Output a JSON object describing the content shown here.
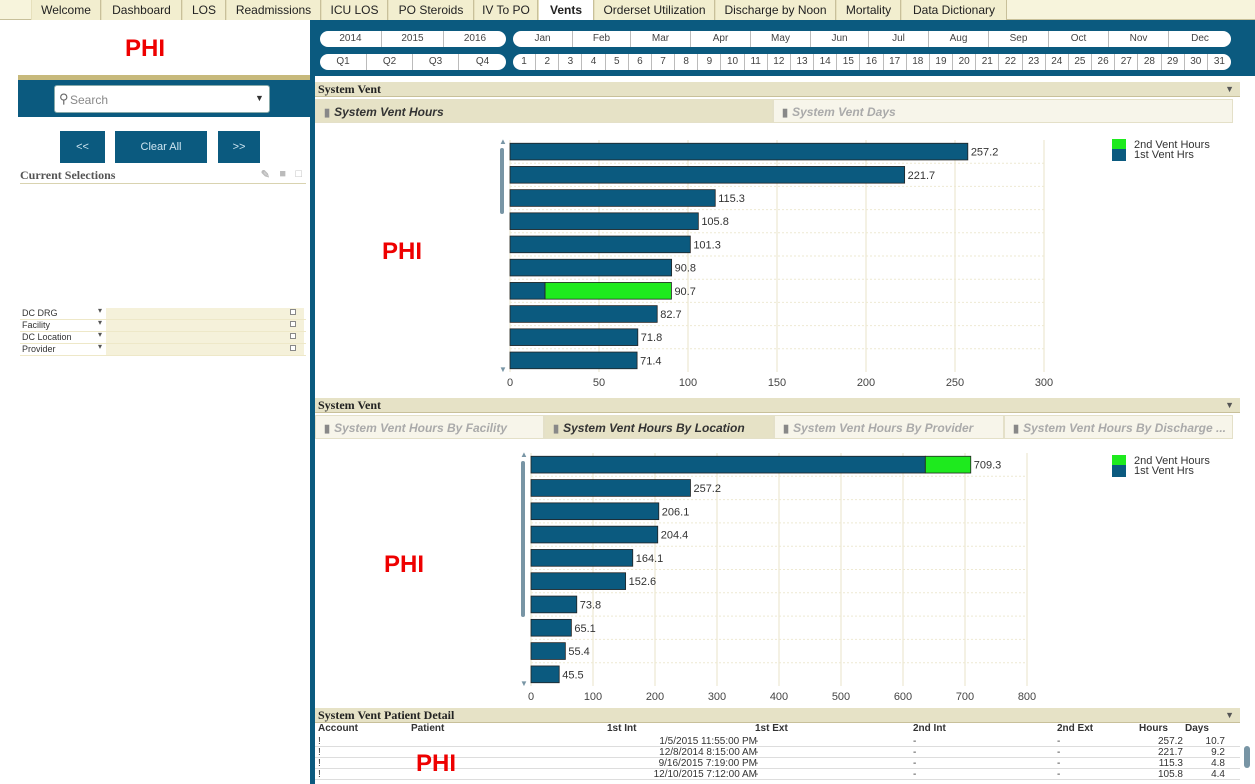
{
  "tabs": [
    {
      "label": "Welcome"
    },
    {
      "label": "Dashboard"
    },
    {
      "label": "LOS"
    },
    {
      "label": "Readmissions"
    },
    {
      "label": "ICU LOS"
    },
    {
      "label": "PO Steroids"
    },
    {
      "label": "IV To PO"
    },
    {
      "label": "Vents"
    },
    {
      "label": "Orderset Utilization"
    },
    {
      "label": "Discharge by Noon"
    },
    {
      "label": "Mortality"
    },
    {
      "label": "Data Dictionary"
    }
  ],
  "phi_label": "PHI",
  "years": [
    "2014",
    "2015",
    "2016"
  ],
  "months": [
    "Jan",
    "Feb",
    "Mar",
    "Apr",
    "May",
    "Jun",
    "Jul",
    "Aug",
    "Sep",
    "Oct",
    "Nov",
    "Dec"
  ],
  "quarters": [
    "Q1",
    "Q2",
    "Q3",
    "Q4"
  ],
  "days": [
    "1",
    "2",
    "3",
    "4",
    "5",
    "6",
    "7",
    "8",
    "9",
    "10",
    "11",
    "12",
    "13",
    "14",
    "15",
    "16",
    "17",
    "18",
    "19",
    "20",
    "21",
    "22",
    "23",
    "24",
    "25",
    "26",
    "27",
    "28",
    "29",
    "30",
    "31"
  ],
  "left": {
    "search_placeholder": "Search",
    "prev_label": "<<",
    "clear_label": "Clear All",
    "next_label": ">>",
    "current_selections": "Current Selections",
    "filters": [
      {
        "label": "DC DRG"
      },
      {
        "label": "Facility"
      },
      {
        "label": "DC Location"
      },
      {
        "label": "Provider"
      }
    ]
  },
  "section1": {
    "title": "System Vent",
    "tabs": [
      {
        "label": "System Vent Hours",
        "active": true
      },
      {
        "label": "System Vent Days",
        "active": false
      }
    ]
  },
  "section2": {
    "title": "System Vent",
    "tabs": [
      {
        "label": "System Vent Hours By Facility",
        "active": false
      },
      {
        "label": "System Vent Hours By Location",
        "active": true
      },
      {
        "label": "System Vent Hours By Provider",
        "active": false
      },
      {
        "label": "System Vent Hours By Discharge ...",
        "active": false
      }
    ]
  },
  "section3": {
    "title": "System Vent Patient Detail"
  },
  "legend": {
    "second": "2nd Vent Hours",
    "first": "1st Vent Hrs"
  },
  "colors": {
    "first": "#0b5a7f",
    "second": "#1eea1e",
    "nav": "#0b5a7f",
    "phi": "#e00000"
  },
  "chart_data": [
    {
      "type": "bar",
      "orientation": "horizontal",
      "stacked": true,
      "xlim": [
        0,
        300
      ],
      "xticks": [
        0,
        50,
        100,
        150,
        200,
        250,
        300
      ],
      "totals": [
        257.2,
        221.7,
        115.3,
        105.8,
        101.3,
        90.8,
        90.7,
        82.7,
        71.8,
        71.4
      ],
      "series": [
        {
          "name": "1st Vent Hrs",
          "values": [
            257.2,
            221.7,
            115.3,
            105.8,
            101.3,
            90.8,
            19.7,
            82.7,
            71.8,
            71.4
          ]
        },
        {
          "name": "2nd Vent Hours",
          "values": [
            0,
            0,
            0,
            0,
            0,
            0,
            71.0,
            0,
            0,
            0
          ]
        }
      ]
    },
    {
      "type": "bar",
      "orientation": "horizontal",
      "stacked": true,
      "xlim": [
        0,
        800
      ],
      "xticks": [
        0,
        100,
        200,
        300,
        400,
        500,
        600,
        700,
        800
      ],
      "totals": [
        709.3,
        257.2,
        206.1,
        204.4,
        164.1,
        152.6,
        73.8,
        65.1,
        55.4,
        45.5
      ],
      "series": [
        {
          "name": "1st Vent Hrs",
          "values": [
            636.0,
            257.2,
            206.1,
            204.4,
            164.1,
            152.6,
            73.8,
            65.1,
            55.4,
            45.5
          ]
        },
        {
          "name": "2nd Vent Hours",
          "values": [
            73.3,
            0,
            0,
            0,
            0,
            0,
            0,
            0,
            0,
            0
          ]
        }
      ]
    }
  ],
  "table": {
    "headers": [
      "Account",
      "Patient",
      "1st Int",
      "1st Ext",
      "2nd Int",
      "2nd Ext",
      "Hours",
      "Days"
    ],
    "rows": [
      {
        "int1": "1/5/2015 11:55:00 PM",
        "ext1": "-",
        "int2": "-",
        "ext2": "-",
        "hours": "257.2",
        "days": "10.7"
      },
      {
        "int1": "12/8/2014 8:15:00 AM",
        "ext1": "-",
        "int2": "-",
        "ext2": "-",
        "hours": "221.7",
        "days": "9.2"
      },
      {
        "int1": "9/16/2015 7:19:00 PM",
        "ext1": "-",
        "int2": "-",
        "ext2": "-",
        "hours": "115.3",
        "days": "4.8"
      },
      {
        "int1": "12/10/2015 7:12:00 AM",
        "ext1": "-",
        "int2": "-",
        "ext2": "-",
        "hours": "105.8",
        "days": "4.4"
      }
    ]
  }
}
